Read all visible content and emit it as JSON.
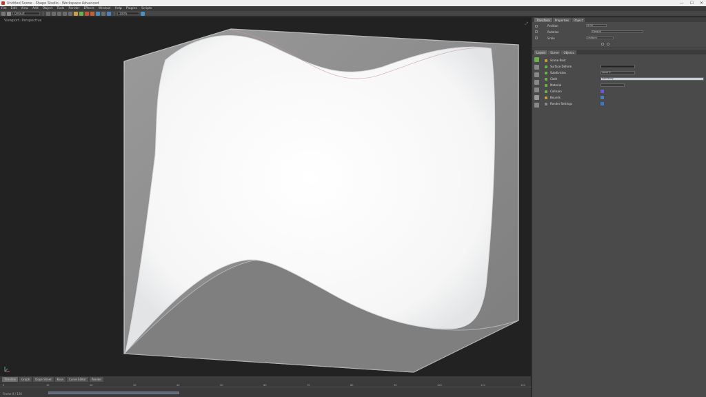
{
  "window": {
    "title": "Untitled Scene - Shape Studio - Workspace Advanced",
    "controls": [
      "—",
      "☐",
      "✕"
    ]
  },
  "menu": [
    "File",
    "Edit",
    "View",
    "Add",
    "Object",
    "Tools",
    "Render",
    "Effects",
    "Window",
    "Help",
    "Plugins",
    "Scripts"
  ],
  "toolbar": {
    "field_value": "Default",
    "zoom_value": "100%"
  },
  "viewport": {
    "label": "Viewport: Perspective",
    "corner_icon": "⤢"
  },
  "panel": {
    "tabs": [
      "Transform",
      "Properties",
      "Object"
    ],
    "props": [
      {
        "label": "Position",
        "value": "0.00"
      },
      {
        "label": "Rotation",
        "value": "Default"
      },
      {
        "label": "Scale",
        "value": "Uniform"
      }
    ],
    "layer_tabs": [
      "Layers",
      "Scene",
      "Objects"
    ],
    "layers": [
      {
        "name": "Scene Root",
        "param": ""
      },
      {
        "name": "Surface Deform",
        "param": ""
      },
      {
        "name": "Subdivision",
        "param": "Level 2"
      },
      {
        "name": "Cloth",
        "param": "Soft Body"
      },
      {
        "name": "Material",
        "param": ""
      },
      {
        "name": "Collision",
        "param": ""
      },
      {
        "name": "Bounds",
        "param": ""
      },
      {
        "name": "Render Settings",
        "param": ""
      }
    ]
  },
  "bottom_tabs": [
    "Timeline",
    "Graph",
    "Dope Sheet",
    "Keys",
    "Curve Editor",
    "Render"
  ],
  "timeline": {
    "ticks": [
      "0",
      "10",
      "20",
      "30",
      "40",
      "50",
      "60",
      "70",
      "80",
      "90",
      "100",
      "110",
      "120"
    ],
    "readout": "Frame 0 / 120"
  },
  "colors": {
    "accent": "#6ab04c",
    "surface": "#f7f7f7",
    "box": "#8a8a8a"
  }
}
